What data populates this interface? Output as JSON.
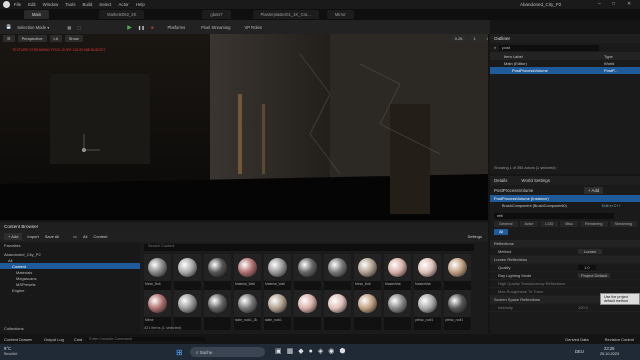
{
  "app": {
    "title": "Abandoned_City_P2",
    "menu": [
      "File",
      "Edit",
      "Window",
      "Tools",
      "Build",
      "Select",
      "Actor",
      "Help"
    ]
  },
  "tabs": [
    {
      "label": "Main"
    },
    {
      "label": "Markets062_2K"
    },
    {
      "label": "glass7"
    },
    {
      "label": "Plasterplaster01_1K_Cra..."
    },
    {
      "label": "Mirror"
    }
  ],
  "toolbar": {
    "selection_mode": "Selection Mode",
    "platforms": "Platforms",
    "pixel_streaming": "Pixel Streaming",
    "vp_roles": "VP Roles"
  },
  "viewport": {
    "perspective": "Perspective",
    "lit": "Lit",
    "show": "Show",
    "warning": "TEXTURE STREAMING POOL OVER 118.83 MiB BUDGET",
    "stats": [
      "0.25",
      "1",
      "4"
    ]
  },
  "outliner": {
    "title": "Outliner",
    "search": "post",
    "col_label": "Item Label",
    "col_type": "Type",
    "rows": [
      {
        "label": "Main (Editor)",
        "type": "World"
      },
      {
        "label": "PostProcessVolume",
        "type": "PostP..."
      }
    ],
    "footer": "Showing 1 of 355 actors (1 selected)"
  },
  "details": {
    "tab1": "Details",
    "tab2": "World Settings",
    "object": "PostProcessVolume",
    "add": "+ Add",
    "instance": "PostProcessVolume (Instance)",
    "component": "BrushComponent (BrushComponent0)",
    "edit_cpp": "Edit in C++",
    "search": "refl",
    "subtabs": [
      "General",
      "Actor",
      "LOD",
      "Misc",
      "Rendering",
      "Streaming",
      "All"
    ],
    "section1": "Reflections",
    "method_label": "Method",
    "method_val": "Lumen",
    "section2": "Lumen Reflections",
    "quality_label": "Quality",
    "quality_val": "1.0",
    "raylight_label": "Ray Lighting Mode",
    "raylight_val": "Project Default",
    "tooltip": "Use the project default method",
    "hq_label": "High Quality Translucency Reflections",
    "max_rough_label": "Max Roughness To Trace",
    "section3": "Screen Space Reflections",
    "intensity_label": "Intensity",
    "intensity_val": "100.0"
  },
  "content_browser": {
    "title": "Content Browser",
    "add": "+ Add",
    "import": "Import",
    "save_all": "Save All",
    "path_all": "All",
    "path_content": "Content",
    "settings": "Settings",
    "search": "Search Content",
    "favorites": "Favorites",
    "project": "Abandoned_City_P2",
    "folders": [
      "All",
      "Content",
      "Materials",
      "Megascans",
      "MSPresets",
      "Engine"
    ],
    "collections": "Collections",
    "count": "421 items (1 selected)",
    "thumbs_row1": [
      "Mesh_Bolt",
      "",
      "",
      "Material_Wall",
      "Material_Wall",
      "",
      "",
      "Mesh_Bolt",
      "MasterMat",
      "MasterMat",
      ""
    ],
    "thumbs_row2": [
      "Mirror",
      "",
      "",
      "slate_rock1_2k",
      "slate_rock1",
      "",
      "",
      "",
      "",
      "pbhsc_roof1",
      "pbhsc_roof1"
    ]
  },
  "statusbar": {
    "content_drawer": "Content Drawer",
    "output_log": "Output Log",
    "cmd": "Cmd",
    "cmd_placeholder": "Enter Console Command",
    "derived": "Derived Data",
    "source": "Revision Control"
  },
  "taskbar": {
    "weather_temp": "9°C",
    "weather_desc": "Bewölkt",
    "search": "Suche",
    "lang": "DEU",
    "time": "23:25",
    "date": "25.10.2023"
  }
}
